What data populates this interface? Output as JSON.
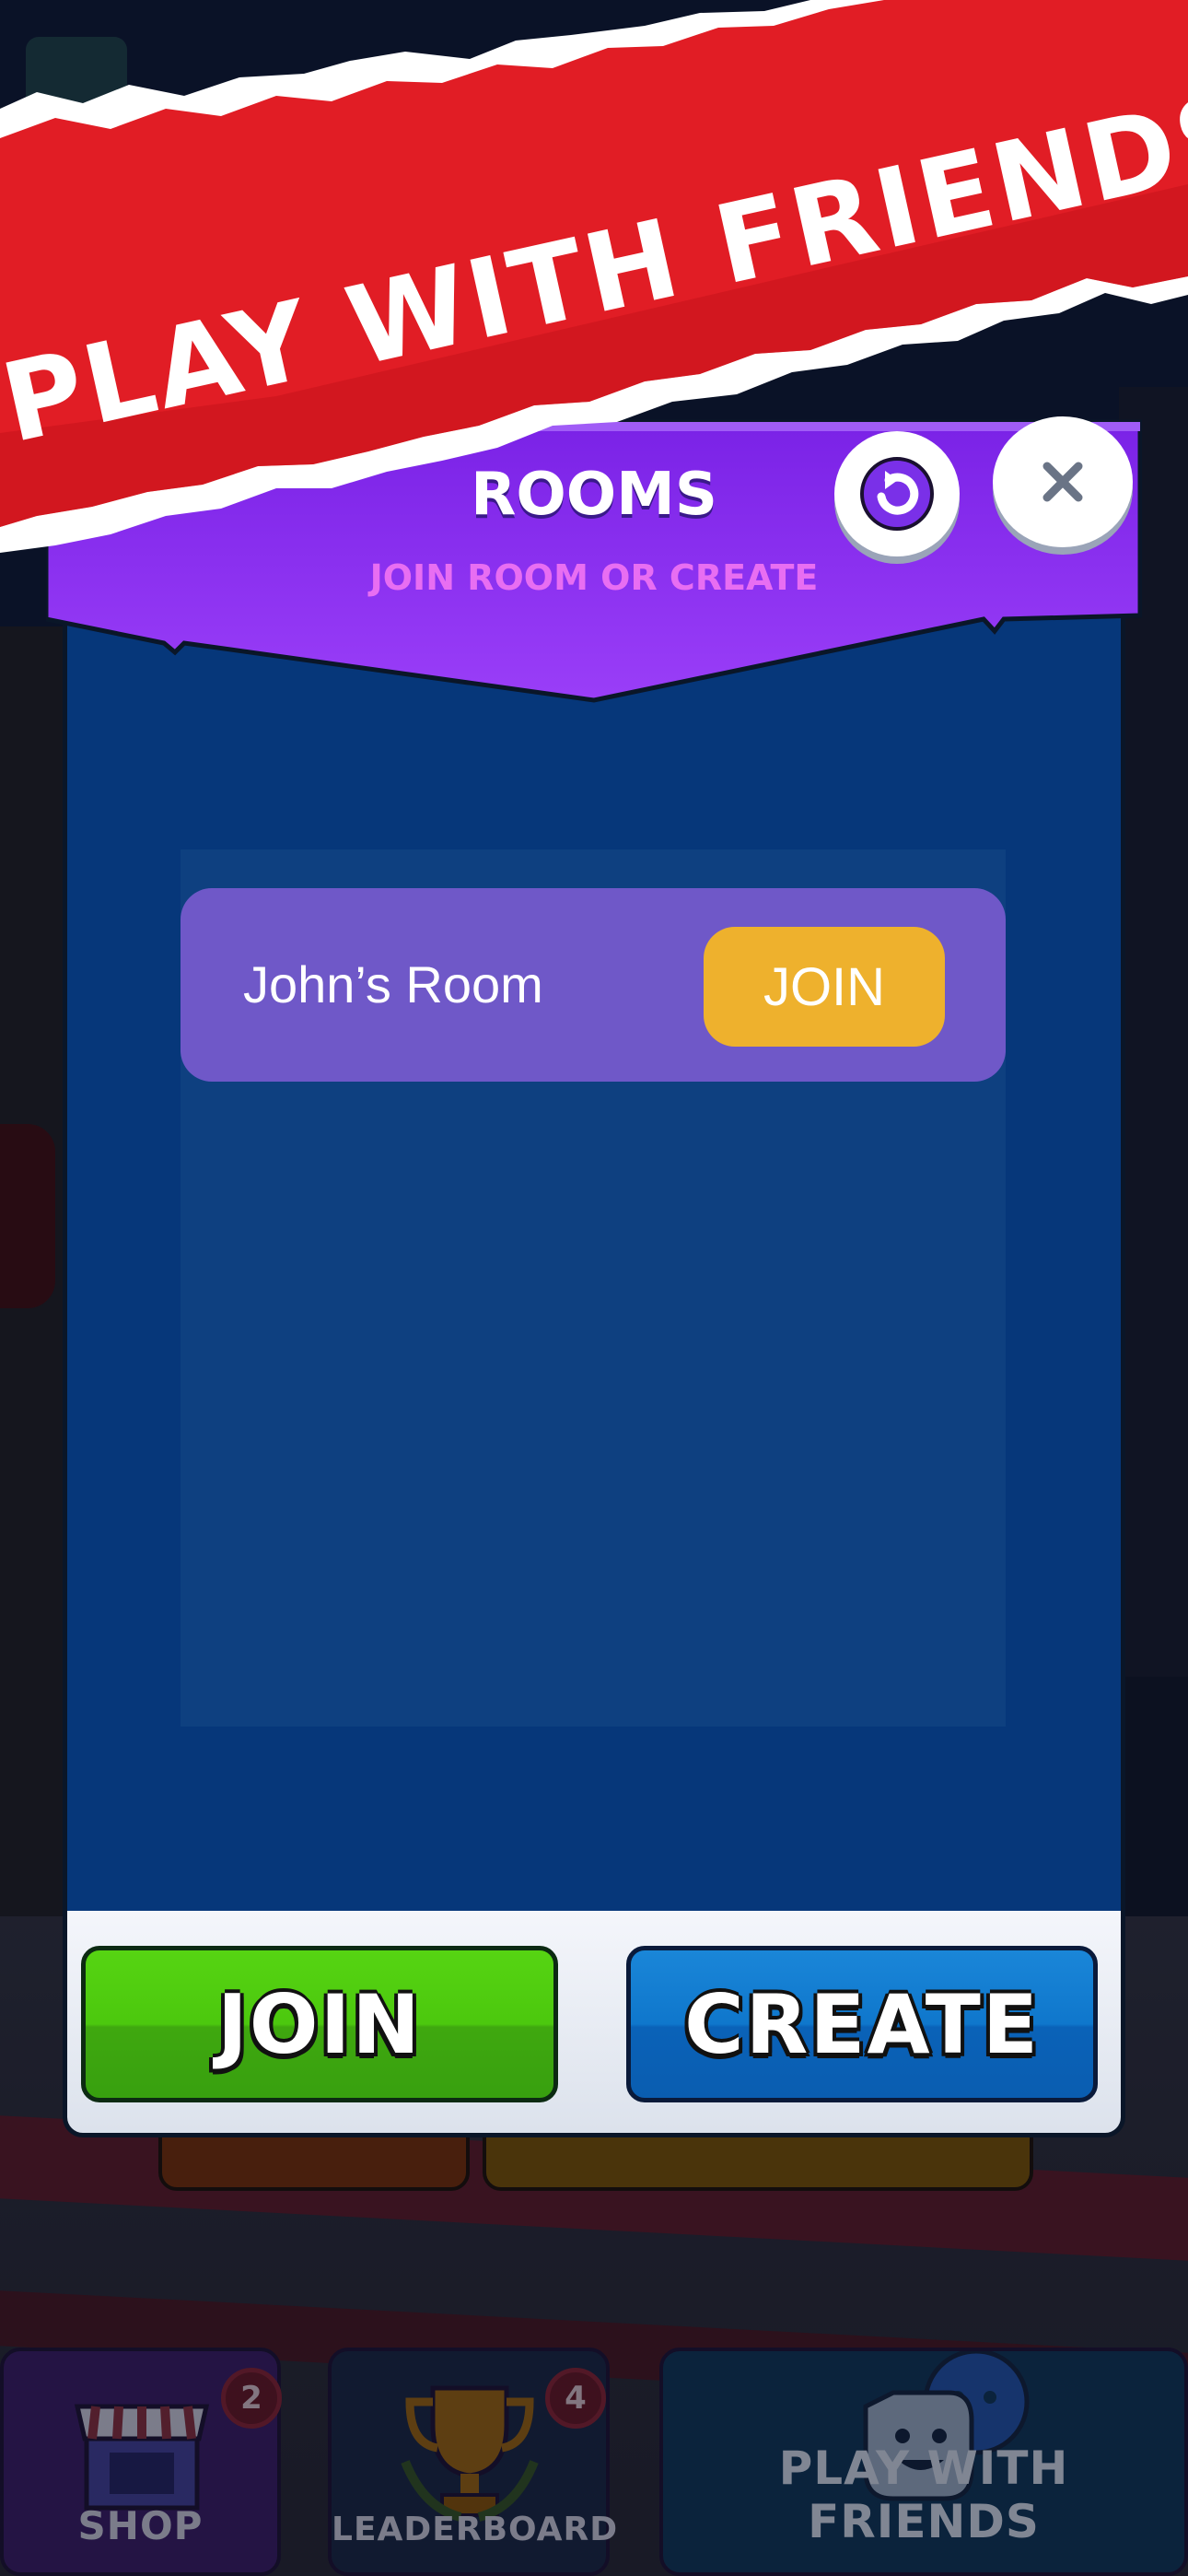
{
  "banner": {
    "title": "PLAY WITH FRIENDS"
  },
  "panel": {
    "title": "ROOMS",
    "subtitle": "JOIN ROOM OR CREATE",
    "rooms": [
      {
        "name": "John’s Room",
        "join_label": "JOIN"
      }
    ],
    "join_button": "JOIN",
    "create_button": "CREATE"
  },
  "nav": {
    "shop": {
      "label": "SHOP",
      "badge": "2"
    },
    "leaderboard": {
      "label": "LEADERBOARD",
      "badge": "4"
    },
    "friends": {
      "label": "PLAY WITH FRIENDS"
    }
  },
  "colors": {
    "banner_red": "#e11d25",
    "header_purple": "#8a2ef0",
    "panel_blue": "#06377a",
    "room_card": "#6f58c8",
    "room_join": "#eeb12d",
    "join_green": "#4cc80e",
    "create_blue": "#0f77cc"
  }
}
